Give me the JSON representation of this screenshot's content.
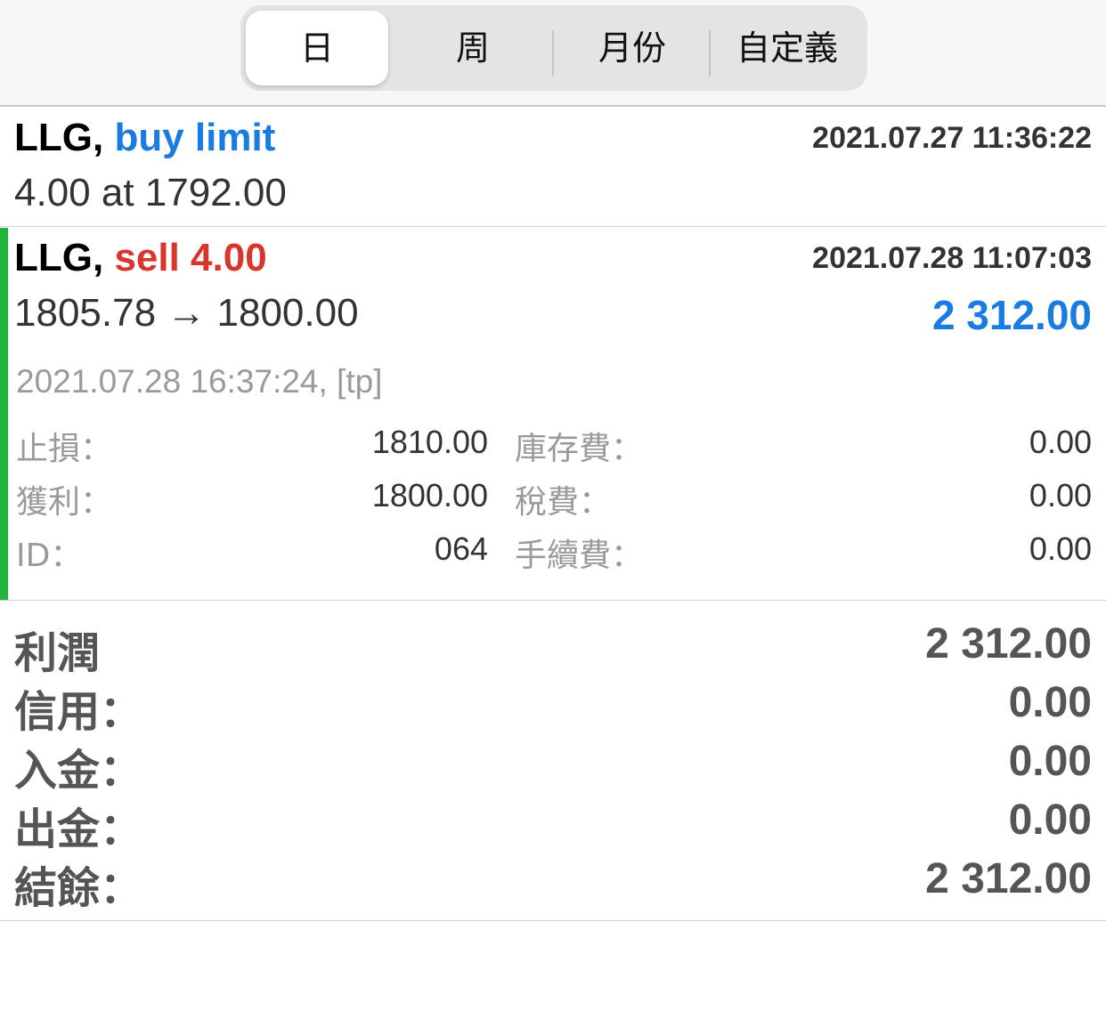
{
  "tabs": [
    {
      "label": "日",
      "active": true
    },
    {
      "label": "周",
      "active": false
    },
    {
      "label": "月份",
      "active": false
    },
    {
      "label": "自定義",
      "active": false
    }
  ],
  "orders": [
    {
      "symbol": "LLG,",
      "action": "buy limit",
      "action_color": "#1a7be0",
      "timestamp": "2021.07.27 11:36:22",
      "detail": "4.00 at 1792.00"
    }
  ],
  "deal": {
    "symbol": "LLG,",
    "action": "sell 4.00",
    "action_color": "#d9362b",
    "timestamp": "2021.07.28 11:07:03",
    "price_move": "1805.78 → 1800.00",
    "profit": "2 312.00",
    "profit_color": "#1a7be0",
    "close_info": "2021.07.28 16:37:24, [tp]",
    "indicator_color": "#1fb53d",
    "fields": [
      {
        "label": "止損：",
        "value": "1810.00",
        "label2": "庫存費：",
        "value2": "0.00"
      },
      {
        "label": "獲利：",
        "value": "1800.00",
        "value_color": "#1fa33a",
        "label2": "稅費：",
        "value2": "0.00"
      },
      {
        "label": "ID：",
        "value": "064",
        "label2": "手續費：",
        "value2": "0.00"
      }
    ]
  },
  "summary": [
    {
      "label": "利潤",
      "value": "2 312.00"
    },
    {
      "label": "信用：",
      "value": "0.00"
    },
    {
      "label": "入金：",
      "value": "0.00"
    },
    {
      "label": "出金：",
      "value": "0.00"
    },
    {
      "label": "結餘：",
      "value": "2 312.00"
    }
  ]
}
